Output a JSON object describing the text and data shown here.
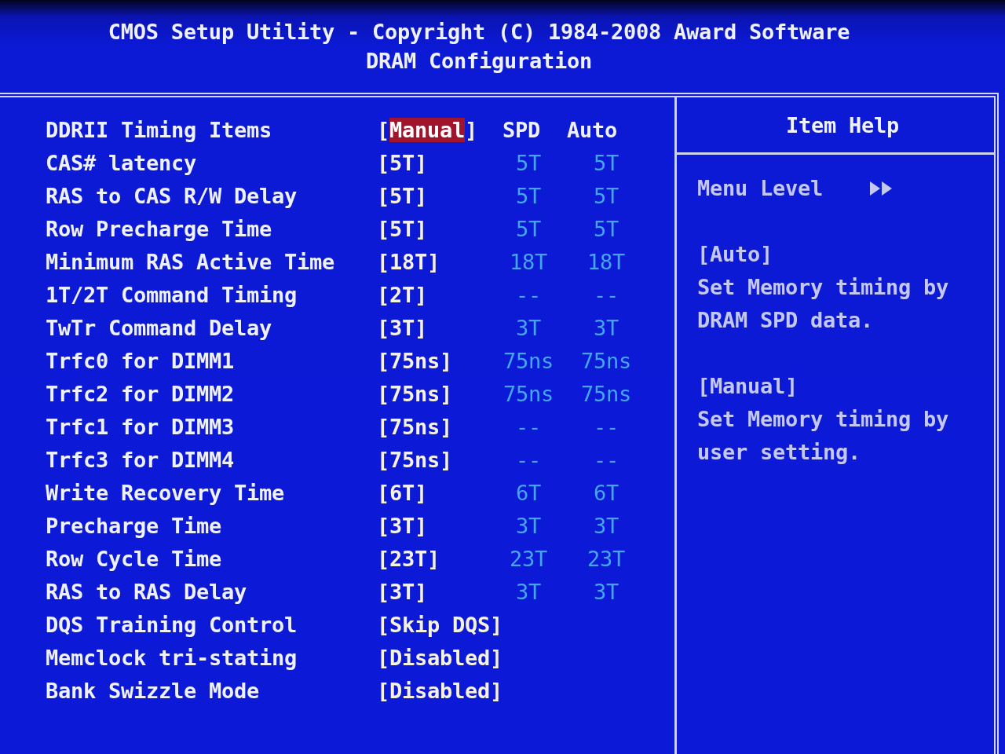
{
  "header": {
    "title": "CMOS Setup Utility - Copyright (C) 1984-2008 Award Software",
    "subtitle": "DRAM Configuration"
  },
  "settings": {
    "column_headers": [
      "SPD",
      "Auto"
    ],
    "items": [
      {
        "label": "DDRII Timing Items",
        "value": "[Manual]",
        "selected": true
      },
      {
        "label": "CAS# latency",
        "value": "[5T]",
        "spd": "5T",
        "auto": "5T",
        "selected": false
      },
      {
        "label": "RAS to CAS R/W Delay",
        "value": "[5T]",
        "spd": "5T",
        "auto": "5T",
        "selected": false
      },
      {
        "label": "Row Precharge Time",
        "value": "[5T]",
        "spd": "5T",
        "auto": "5T",
        "selected": false
      },
      {
        "label": "Minimum RAS Active Time",
        "value": "[18T]",
        "spd": "18T",
        "auto": "18T",
        "selected": false
      },
      {
        "label": "1T/2T Command Timing",
        "value": "[2T]",
        "spd": "--",
        "auto": "--",
        "selected": false
      },
      {
        "label": "TwTr Command Delay",
        "value": "[3T]",
        "spd": "3T",
        "auto": "3T",
        "selected": false
      },
      {
        "label": "Trfc0 for DIMM1",
        "value": "[75ns]",
        "spd": "75ns",
        "auto": "75ns",
        "selected": false
      },
      {
        "label": "Trfc2 for DIMM2",
        "value": "[75ns]",
        "spd": "75ns",
        "auto": "75ns",
        "selected": false
      },
      {
        "label": "Trfc1 for DIMM3",
        "value": "[75ns]",
        "spd": "--",
        "auto": "--",
        "selected": false
      },
      {
        "label": "Trfc3 for DIMM4",
        "value": "[75ns]",
        "spd": "--",
        "auto": "--",
        "selected": false
      },
      {
        "label": "Write Recovery Time",
        "value": "[6T]",
        "spd": "6T",
        "auto": "6T",
        "selected": false
      },
      {
        "label": "Precharge Time",
        "value": "[3T]",
        "spd": "3T",
        "auto": "3T",
        "selected": false
      },
      {
        "label": "Row Cycle Time",
        "value": "[23T]",
        "spd": "23T",
        "auto": "23T",
        "selected": false
      },
      {
        "label": "RAS to RAS Delay",
        "value": "[3T]",
        "spd": "3T",
        "auto": "3T",
        "selected": false
      },
      {
        "label": "DQS Training Control",
        "value": "[Skip DQS]",
        "selected": false
      },
      {
        "label": "Memclock tri-stating",
        "value": "[Disabled]",
        "selected": false
      },
      {
        "label": "Bank Swizzle Mode",
        "value": "[Disabled]",
        "selected": false
      }
    ]
  },
  "help": {
    "title": "Item Help",
    "menu_level": "Menu Level",
    "entries": [
      {
        "option": "[Auto]",
        "description": "Set Memory timing by DRAM SPD data."
      },
      {
        "option": "[Manual]",
        "description": "Set Memory timing by user setting."
      }
    ]
  }
}
